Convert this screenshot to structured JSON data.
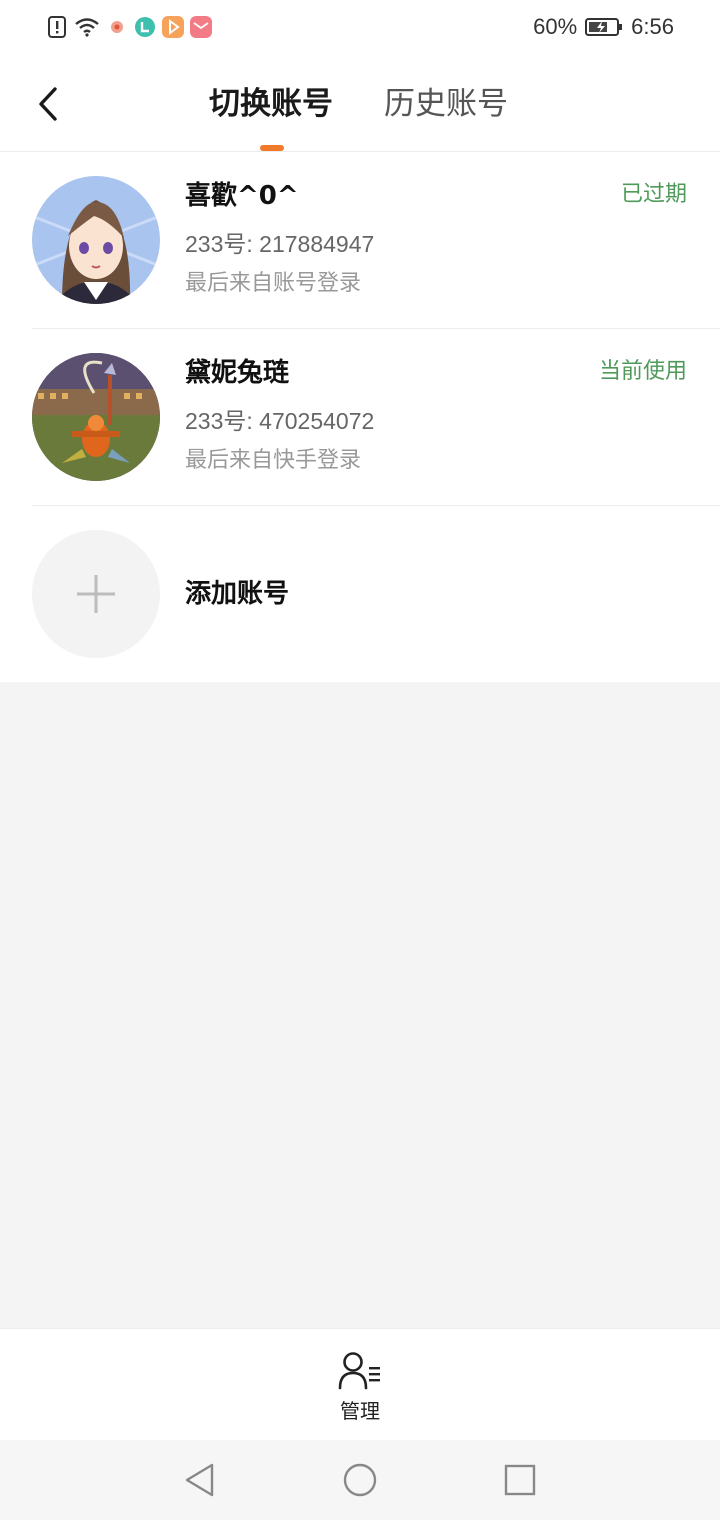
{
  "status_bar": {
    "battery": "60%",
    "time": "6:56",
    "icons": [
      "sim-alert-icon",
      "wifi-icon",
      "app-badge-red",
      "app-badge-teal",
      "app-badge-orange",
      "app-badge-pink"
    ]
  },
  "header": {
    "back_icon": "back-arrow-icon",
    "tabs": [
      {
        "label": "切换账号",
        "active": true
      },
      {
        "label": "历史账号",
        "active": false
      }
    ]
  },
  "accounts": [
    {
      "name": "喜歡^0^",
      "id_line": "233号: 217884947",
      "source": "最后来自账号登录",
      "status": "已过期"
    },
    {
      "name": "黛妮兔琏",
      "id_line": "233号: 470254072",
      "source": "最后来自快手登录",
      "status": "当前使用"
    }
  ],
  "add_account": {
    "label": "添加账号"
  },
  "manage": {
    "label": "管理"
  },
  "colors": {
    "accent": "#f07a2a",
    "status_green": "#4f9a5b",
    "background": "#f4f4f4"
  }
}
